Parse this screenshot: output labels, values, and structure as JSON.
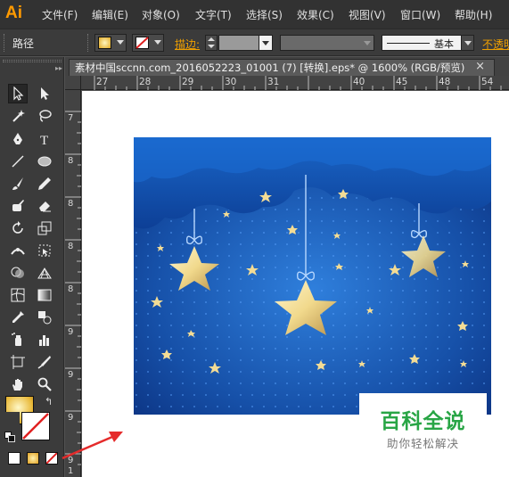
{
  "app": {
    "logo": "Ai"
  },
  "menu": [
    {
      "label": "文件(F)",
      "icon": "none"
    },
    {
      "label": "编辑(E)"
    },
    {
      "label": "对象(O)"
    },
    {
      "label": "文字(T)"
    },
    {
      "label": "选择(S)"
    },
    {
      "label": "效果(C)"
    },
    {
      "label": "视图(V)"
    },
    {
      "label": "窗口(W)"
    },
    {
      "label": "帮助(H)"
    }
  ],
  "control_bar": {
    "selection_label": "路径",
    "stroke_label": "描边:",
    "style_value": "基本",
    "opacity_label": "不透明"
  },
  "document": {
    "tab_title": "素材中国sccnn.com_2016052223_01001  (7)  [转换].eps* @ 1600% (RGB/预览)",
    "close_label": "×"
  },
  "ruler": {
    "top_labels": [
      "27",
      "28",
      "29",
      "30",
      "31",
      "40",
      "45",
      "48",
      "54"
    ],
    "left_labels": [
      "7",
      "8",
      "8",
      "8",
      "8",
      "9",
      "9",
      "9",
      "9",
      "1"
    ]
  },
  "watermark": {
    "title": "百科全说",
    "subtitle": "助你轻松解决"
  },
  "colors": {
    "accent": "#ff9a00",
    "sky_dark": "#0a2d7a",
    "sky_light": "#2f7fdc",
    "star": "#f3dc95",
    "watermark_green": "#28a545"
  },
  "tools": [
    "selection-tool-icon",
    "direct-selection-tool-icon",
    "magic-wand-icon",
    "lasso-icon",
    "pen-tool-icon",
    "type-tool-icon",
    "line-tool-icon",
    "ellipse-tool-icon",
    "paintbrush-icon",
    "pencil-icon",
    "blob-brush-icon",
    "eraser-icon",
    "rotate-icon",
    "scale-icon",
    "width-tool-icon",
    "free-transform-icon",
    "shape-builder-icon",
    "perspective-grid-icon",
    "mesh-icon",
    "gradient-icon",
    "eyedropper-icon",
    "blend-icon",
    "symbol-sprayer-icon",
    "column-graph-icon",
    "artboard-icon",
    "slice-icon",
    "hand-icon",
    "zoom-icon"
  ]
}
